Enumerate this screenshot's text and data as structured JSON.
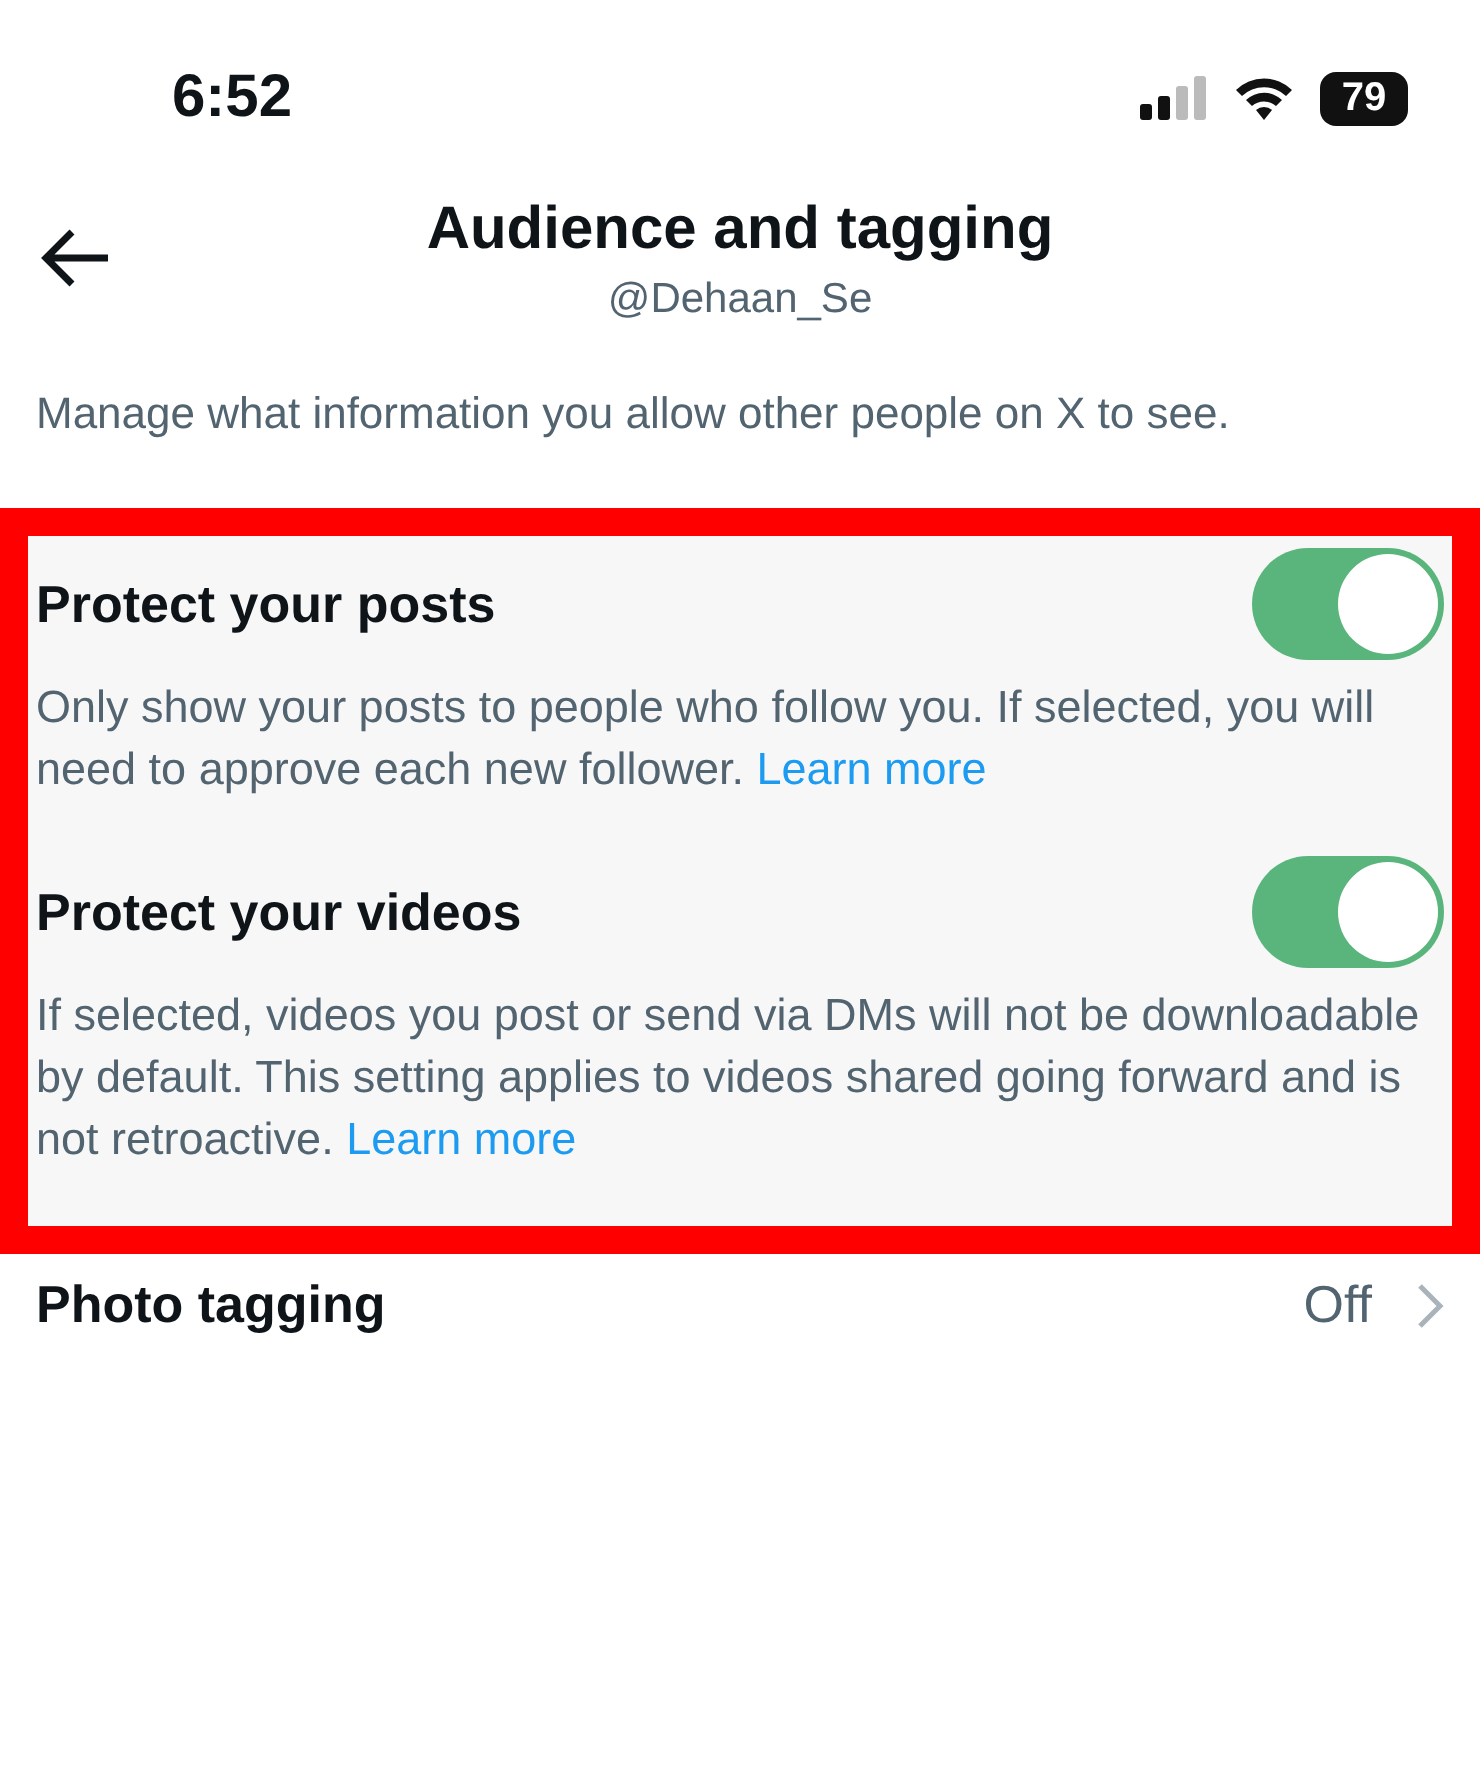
{
  "status_bar": {
    "time": "6:52",
    "battery": "79"
  },
  "header": {
    "title": "Audience and tagging",
    "subtitle": "@Dehaan_Se"
  },
  "description": "Manage what information you allow other people on X to see.",
  "highlighted_settings": [
    {
      "title": "Protect your posts",
      "on": true,
      "description": "Only show your posts to people who follow you. If selected, you will need to approve each new follower.",
      "link": "Learn more"
    },
    {
      "title": "Protect your videos",
      "on": true,
      "description": "If selected, videos you post or send via DMs will not be downloadable by default. This setting applies to videos shared going forward and is not retroactive.",
      "link": "Learn more"
    }
  ],
  "rows": [
    {
      "label": "Photo tagging",
      "value": "Off"
    }
  ]
}
